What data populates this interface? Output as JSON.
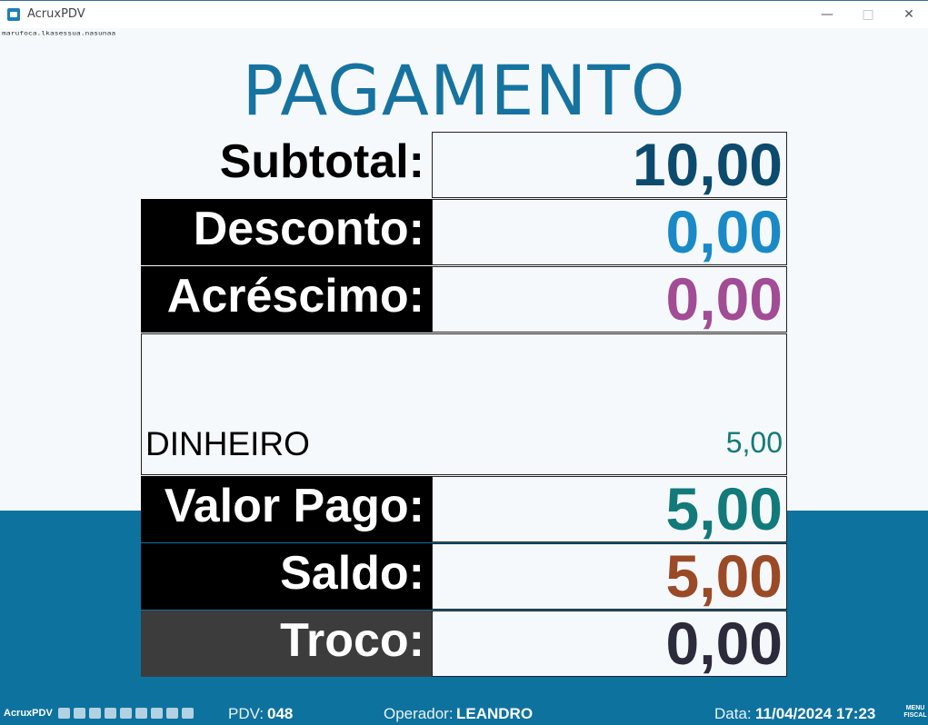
{
  "window": {
    "title": "AcruxPDV",
    "small_text": "marufoca.lkasessua.nasunaa"
  },
  "heading": "PAGAMENTO",
  "summary": {
    "subtotal": {
      "label": "Subtotal:",
      "value": "10,00",
      "color": "#0d4b6e"
    },
    "desconto": {
      "label": "Desconto:",
      "value": "0,00",
      "color": "#1a8ac7"
    },
    "acrescimo": {
      "label": "Acréscimo:",
      "value": "0,00",
      "color": "#a24c95"
    }
  },
  "payments": [
    {
      "method": "DINHEIRO",
      "amount": "5,00"
    }
  ],
  "totals": {
    "valor_pago": {
      "label": "Valor Pago:",
      "value": "5,00",
      "color": "#127a7a"
    },
    "saldo": {
      "label": "Saldo:",
      "value": "5,00",
      "color": "#9b4a28"
    },
    "troco": {
      "label": "Troco:",
      "value": "0,00",
      "color": "#2b2b3c"
    }
  },
  "statusbar": {
    "app": "AcruxPDV",
    "pdv_label": "PDV:",
    "pdv_value": "048",
    "operador_label": "Operador:",
    "operador_value": "LEANDRO",
    "data_label": "Data:",
    "data_value": "11/04/2024 17:23",
    "menu_fiscal": "MENU FISCAL"
  },
  "colors": {
    "accent_blue": "#0e729e",
    "heading": "#1673a0"
  }
}
